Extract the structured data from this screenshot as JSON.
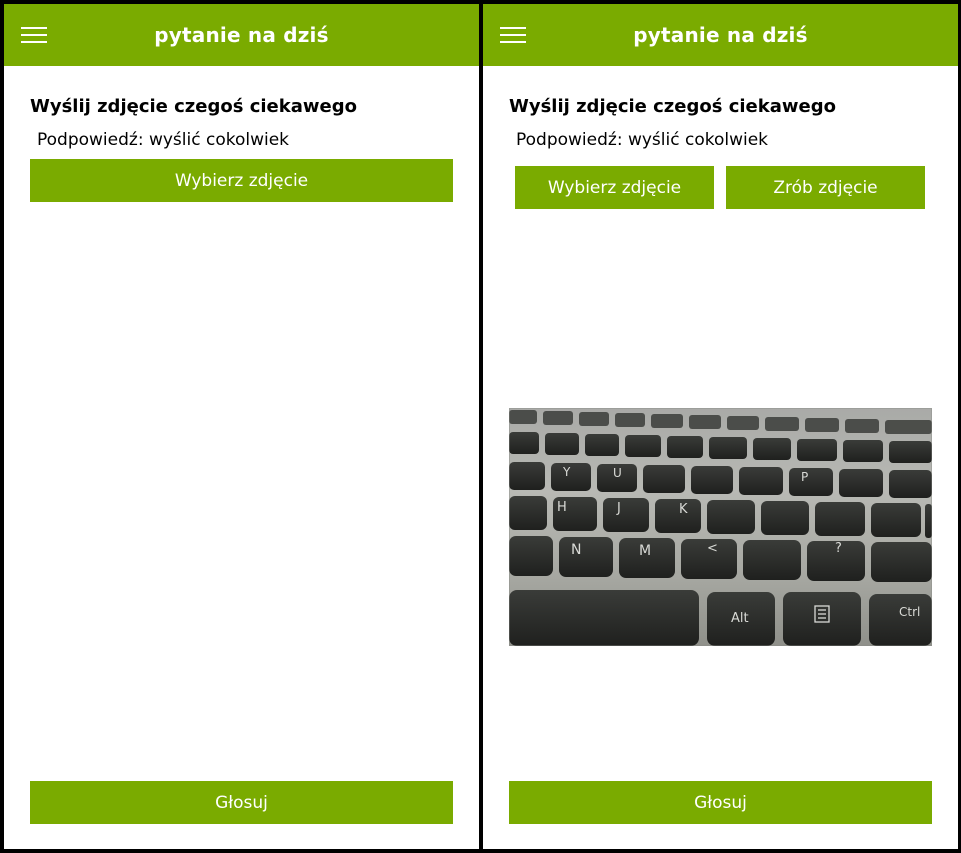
{
  "screens": [
    {
      "app_title": "pytanie na dziś",
      "question_title": "Wyślij zdjęcie czegoś ciekawego",
      "hint": "Podpowiedź: wyślić cokolwiek",
      "pick_button": "Wybierz zdjęcie",
      "vote_button": "Głosuj"
    },
    {
      "app_title": "pytanie na dziś",
      "question_title": "Wyślij zdjęcie czegoś ciekawego",
      "hint": "Podpowiedź: wyślić cokolwiek",
      "pick_button": "Wybierz zdjęcie",
      "take_button": "Zrób zdjęcie",
      "vote_button": "Głosuj",
      "photo_keys": [
        "Y",
        "U",
        "P",
        "H",
        "J",
        "K",
        "N",
        "M",
        "<",
        "?",
        "Alt",
        "Ctrl"
      ]
    }
  ],
  "colors": {
    "accent": "#7aab00",
    "background": "#ffffff",
    "text": "#000000"
  },
  "icons": {
    "menu": "hamburger-menu-icon",
    "context_menu_key": "menu-key-icon"
  }
}
